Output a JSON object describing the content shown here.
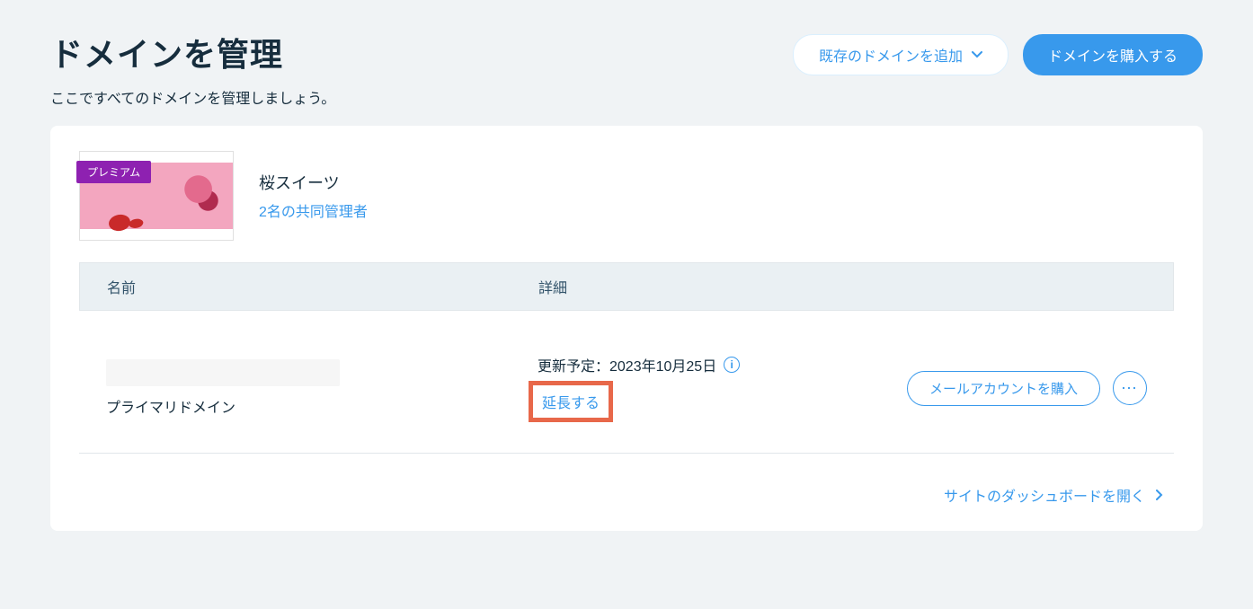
{
  "header": {
    "title": "ドメインを管理",
    "subtitle": "ここですべてのドメインを管理しましょう。",
    "add_existing_label": "既存のドメインを追加",
    "buy_domain_label": "ドメインを購入する"
  },
  "site": {
    "badge": "プレミアム",
    "name": "桜スイーツ",
    "coadmins_label": "2名の共同管理者"
  },
  "table": {
    "col_name": "名前",
    "col_detail": "詳細",
    "row": {
      "domain_type": "プライマリドメイン",
      "renewal_text": "更新予定：2023年10月25日",
      "extend_label": "延長する",
      "buy_mail_label": "メールアカウントを購入"
    }
  },
  "footer": {
    "open_dashboard_label": "サイトのダッシュボードを開く"
  },
  "colors": {
    "accent": "#3899ec",
    "highlight_border": "#e8684a",
    "badge": "#8e21b1"
  }
}
